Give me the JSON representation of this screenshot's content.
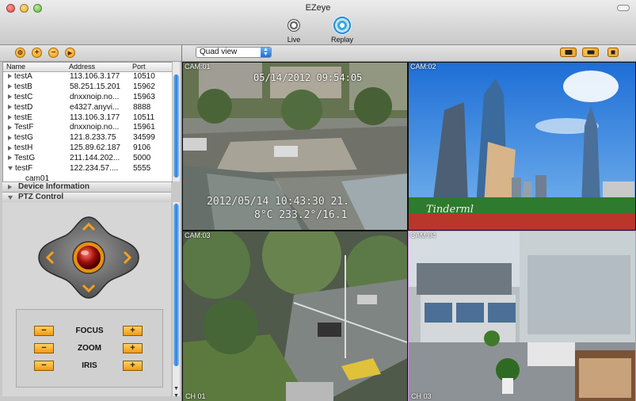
{
  "window": {
    "title": "EZeye"
  },
  "toolbar": {
    "live_label": "Live",
    "replay_label": "Replay"
  },
  "device_list": {
    "columns": [
      "Name",
      "Address",
      "Port"
    ],
    "rows": [
      {
        "name": "testA",
        "address": "113.106.3.177",
        "port": "10510"
      },
      {
        "name": "testB",
        "address": "58.251.15.201",
        "port": "15962"
      },
      {
        "name": "testC",
        "address": "dnxxnoip.no...",
        "port": "15963"
      },
      {
        "name": "testD",
        "address": "e4327.anyvi...",
        "port": "8888"
      },
      {
        "name": "testE",
        "address": "113.106.3.177",
        "port": "10511"
      },
      {
        "name": "TestF",
        "address": "dnxxnoip.no...",
        "port": "15961"
      },
      {
        "name": "testG",
        "address": "121.8.233.75",
        "port": "34599"
      },
      {
        "name": "testH",
        "address": "125.89.62.187",
        "port": "9106"
      },
      {
        "name": "TestG",
        "address": "211.144.202...",
        "port": "5000"
      },
      {
        "name": "testF",
        "address": "122.234.57....",
        "port": "5555"
      }
    ],
    "child": "cam01"
  },
  "sections": {
    "device_info": "Device Information",
    "ptz": "PTZ Control"
  },
  "ptz": {
    "focus": "FOCUS",
    "zoom": "ZOOM",
    "iris": "IRIS",
    "minus": "−",
    "plus": "+"
  },
  "view": {
    "mode": "Quad view"
  },
  "cams": [
    {
      "label": "CAM:01",
      "osd_datetime": "05/14/2012 09:54:05",
      "osd_bottom1": "2012/05/14 10:43:30 21.",
      "osd_bottom2": "8°C  233.2°/16.1"
    },
    {
      "label": "CAM:02",
      "watermark": "Tinderml"
    },
    {
      "label": "CAM:03",
      "ch": "CH 01"
    },
    {
      "label": "CAM:04",
      "ch": "CH 03"
    }
  ],
  "colors": {
    "accent": "#f09a10",
    "scroll": "#2d7fd8"
  }
}
